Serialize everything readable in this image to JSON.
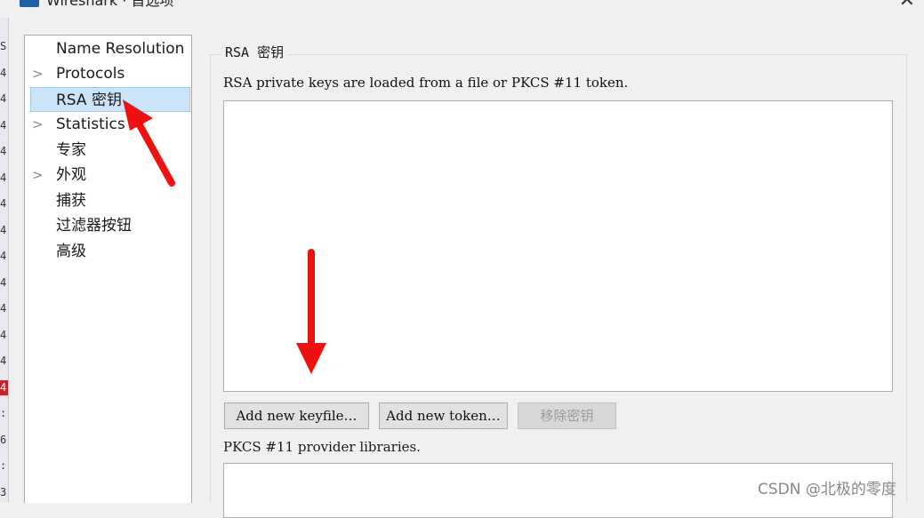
{
  "window": {
    "title": "Wireshark · 首选项",
    "close_icon": "close-icon"
  },
  "background_strip": [
    "S",
    "4",
    "4",
    "4",
    "4",
    "4",
    "4",
    "4",
    "4",
    "4",
    "4",
    "4",
    "4",
    "4",
    ":",
    "6",
    ":",
    "3"
  ],
  "tree": {
    "items": [
      {
        "label": "Name Resolution",
        "expandable": false,
        "selected": false
      },
      {
        "label": "Protocols",
        "expandable": true,
        "selected": false
      },
      {
        "label": "RSA 密钥",
        "expandable": false,
        "selected": true
      },
      {
        "label": "Statistics",
        "expandable": true,
        "selected": false
      },
      {
        "label": "专家",
        "expandable": false,
        "selected": false
      },
      {
        "label": "外观",
        "expandable": true,
        "selected": false
      },
      {
        "label": "捕获",
        "expandable": false,
        "selected": false
      },
      {
        "label": "过滤器按钮",
        "expandable": false,
        "selected": false
      },
      {
        "label": "高级",
        "expandable": false,
        "selected": false
      }
    ],
    "chevron_icon": "chevron-right-icon"
  },
  "panel": {
    "group_title": "RSA 密钥",
    "description": "RSA private keys are loaded from a file or PKCS #11 token.",
    "buttons": {
      "add_keyfile": "Add new keyfile…",
      "add_token": "Add new token…",
      "remove_key": "移除密钥"
    },
    "pkcs_label": "PKCS #11 provider libraries."
  },
  "watermark": "CSDN @北极的零度",
  "annotation_color": "#ee1111"
}
